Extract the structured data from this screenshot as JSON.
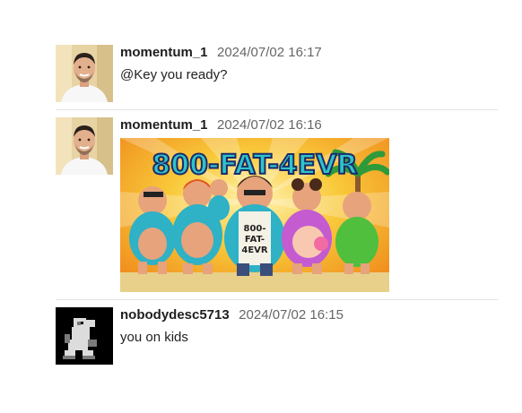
{
  "messages": [
    {
      "username": "momentum_1",
      "timestamp": "2024/07/02 16:17",
      "text": "@Key you ready?",
      "avatar": "man-smiling-photo"
    },
    {
      "username": "momentum_1",
      "timestamp": "2024/07/02 16:16",
      "text": "",
      "avatar": "man-smiling-photo",
      "image": {
        "banner_text": "800-FAT-4EVR",
        "shirt_text": [
          "800-",
          "FAT-",
          "4EVR"
        ]
      }
    },
    {
      "username": "nobodydesc5713",
      "timestamp": "2024/07/02 16:15",
      "text": "you on kids",
      "avatar": "pixel-yoshi-sprite"
    }
  ],
  "colors": {
    "divider": "#e4e4e4",
    "username": "#1e1e1e",
    "timestamp": "#666666",
    "banner_fill": "#2ec4c9",
    "banner_outline": "#1b2a6b"
  }
}
